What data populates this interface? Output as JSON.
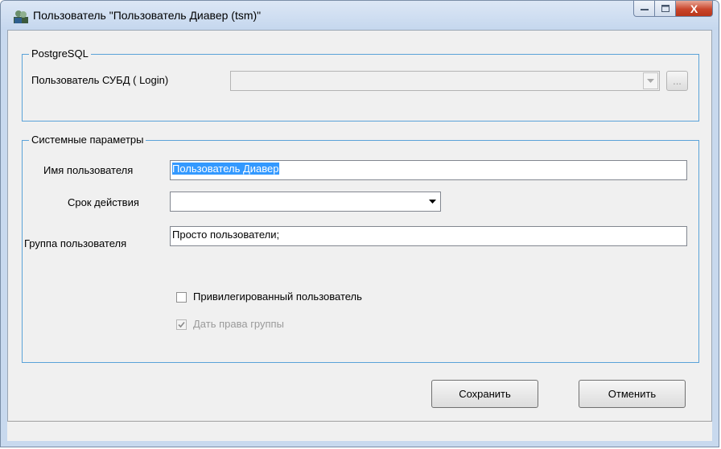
{
  "window": {
    "title": "Пользователь \"Пользователь Диавер (tsm)\"",
    "minimize_glyph": "—",
    "maximize_glyph": "☐",
    "close_glyph": "X"
  },
  "postgres": {
    "legend": "PostgreSQL",
    "login_label": "Пользователь СУБД ( Login)",
    "login_value": "",
    "browse_label": "..."
  },
  "system": {
    "legend": "Системные параметры",
    "username_label": "Имя пользователя",
    "username_value": "Пользователь Диавер",
    "expiry_label": "Срок действия",
    "expiry_value": "",
    "group_label": "Группа пользователя",
    "group_value": "Просто пользователи;",
    "privileged_label": "Привилегированный пользователь",
    "privileged_checked": false,
    "group_rights_label": "Дать права группы",
    "group_rights_checked": true
  },
  "buttons": {
    "save": "Сохранить",
    "cancel": "Отменить"
  },
  "icons": [
    "users-icon",
    "minimize-icon",
    "maximize-icon",
    "close-icon",
    "dropdown-arrow-icon",
    "checkmark-icon"
  ]
}
